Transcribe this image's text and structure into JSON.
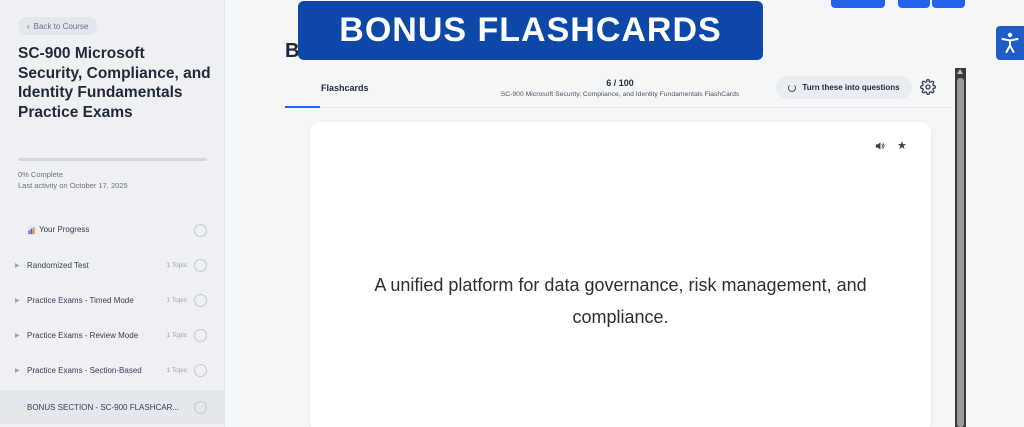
{
  "sidebar": {
    "back_label": "Back to Course",
    "course_title": "SC-900 Microsoft Security, Compliance, and Identity Fundamentals Practice Exams",
    "progress": {
      "percent": 0,
      "label": "0% Complete",
      "last_activity": "Last activity on October 17, 2025"
    },
    "your_progress": "Your Progress",
    "items": [
      {
        "label": "Randomized Test",
        "topics": "1 Topic"
      },
      {
        "label": "Practice Exams - Timed Mode",
        "topics": "1 Topic"
      },
      {
        "label": "Practice Exams - Review Mode",
        "topics": "1 Topic"
      },
      {
        "label": "Practice Exams - Section-Based",
        "topics": "1 Topic"
      },
      {
        "label": "BONUS SECTION - SC-900 FLASHCAR...",
        "topics": ""
      }
    ]
  },
  "banner": {
    "text": "BONUS FLASHCARDS"
  },
  "main": {
    "heading": "B",
    "tab_label": "Flashcards",
    "counter": "6 / 100",
    "deck_name": "SC-900 Microsoft Security, Compliance, and Identity Fundamentals FlashCards",
    "turn_button": "Turn these into questions",
    "card_text": "A unified platform for data governance, risk management, and compliance."
  },
  "colors": {
    "accent": "#2563eb",
    "banner": "#0d47a8",
    "accessibility": "#1f5dc6"
  },
  "icons": [
    "chevron-left-icon",
    "bar-chart-icon",
    "caret-right-icon",
    "spinner-icon",
    "gear-icon",
    "speaker-icon",
    "star-icon",
    "accessibility-icon"
  ]
}
